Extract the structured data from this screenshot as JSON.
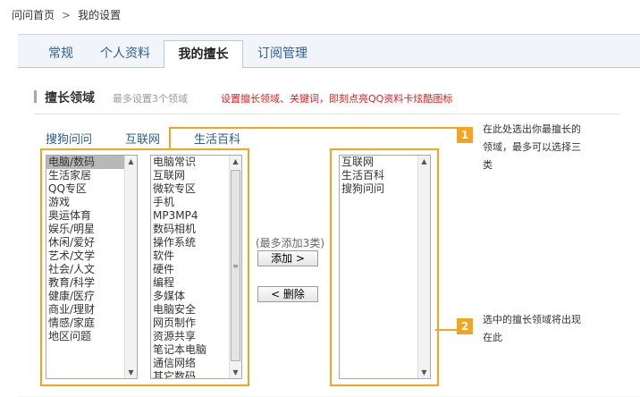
{
  "breadcrumb": {
    "home": "问问首页",
    "separator": ">",
    "current": "我的设置"
  },
  "tabs": [
    {
      "label": "常规"
    },
    {
      "label": "个人资料"
    },
    {
      "label": "我的擅长"
    },
    {
      "label": "订阅管理"
    }
  ],
  "section": {
    "title": "擅长领域",
    "limit_note": "最多设置3个领域",
    "hint": "设置擅长领域、关键词，即刻点亮QQ资料卡炫酷图标"
  },
  "categories": [
    {
      "label": "搜狗问问"
    },
    {
      "label": "互联网"
    },
    {
      "label": "生活百科"
    }
  ],
  "left_list": [
    "电脑/数码",
    "生活家居",
    "QQ专区",
    "游戏",
    "奥运体育",
    "娱乐/明星",
    "休闲/爱好",
    "艺术/文学",
    "社会/人文",
    "教育/科学",
    "健康/医疗",
    "商业/理财",
    "情感/家庭",
    "地区问题"
  ],
  "middle_list": [
    "电脑常识",
    "互联网",
    "微软专区",
    "手机",
    "MP3MP4",
    "数码相机",
    "操作系统",
    "软件",
    "硬件",
    "编程",
    "多媒体",
    "电脑安全",
    "网页制作",
    "资源共享",
    "笔记本电脑",
    "通信网络",
    "其它数码"
  ],
  "selected_list": [
    "互联网",
    "生活百科",
    "搜狗问问"
  ],
  "controls": {
    "limit": "(最多添加3类)",
    "add": "添加 >",
    "remove": "< 删除"
  },
  "tips": [
    {
      "num": "1",
      "text": "在此处选出你最擅长的领域，最多可以选择三类"
    },
    {
      "num": "2",
      "text": "选中的擅长领域将出现在此"
    }
  ],
  "colors": {
    "accent": "#f5a51b",
    "link": "#2a5c9a",
    "warning": "#e02020"
  }
}
